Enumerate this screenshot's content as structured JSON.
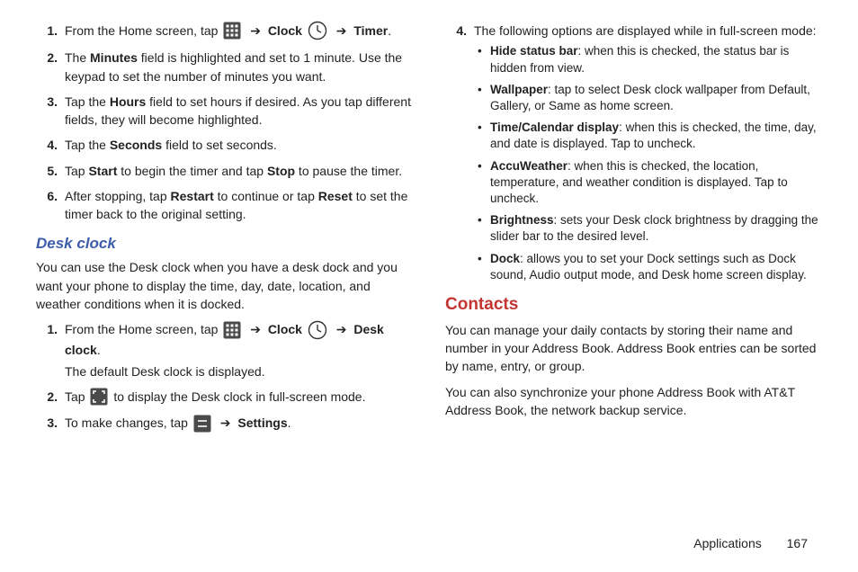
{
  "footer": {
    "section": "Applications",
    "page": "167"
  },
  "arrow_glyph": "➔",
  "left": {
    "steps1": [
      {
        "n": "1.",
        "pre": "From the Home screen, tap ",
        "icon1": "apps-grid-icon",
        "mid1": " ",
        "bold1": "Clock",
        "mid2": " ",
        "icon2": "clock-icon",
        "post": " ",
        "tail_bold": "Timer",
        "tail": "."
      },
      {
        "n": "2.",
        "text_a": "The ",
        "b1": "Minutes",
        "text_b": " field is highlighted and set to 1 minute. Use the keypad to set the number of minutes you want."
      },
      {
        "n": "3.",
        "text_a": "Tap the ",
        "b1": "Hours",
        "text_b": " field to set hours if desired. As you tap different fields, they will become highlighted."
      },
      {
        "n": "4.",
        "text_a": "Tap the ",
        "b1": "Seconds",
        "text_b": " field to set seconds."
      },
      {
        "n": "5.",
        "text_a": "Tap ",
        "b1": "Start",
        "text_b": " to begin the timer and tap ",
        "b2": "Stop",
        "text_c": " to pause the timer."
      },
      {
        "n": "6.",
        "text_a": "After stopping, tap ",
        "b1": "Restart",
        "text_b": " to continue or tap ",
        "b2": "Reset",
        "text_c": " to set the timer back to the original setting."
      }
    ],
    "desk_clock_heading": "Desk clock",
    "desk_clock_intro": "You can use the Desk clock when you have a desk dock and you want your phone to display the time, day, date, location, and weather conditions when it is docked.",
    "steps2": {
      "s1": {
        "n": "1.",
        "pre": "From the Home screen, tap ",
        "bold1": "Clock",
        "tail_bold": "Desk clock",
        "tail": ".",
        "sub": "The default Desk clock is displayed."
      },
      "s2": {
        "n": "2.",
        "pre": "Tap ",
        "post": " to display the Desk clock in full-screen mode."
      },
      "s3": {
        "n": "3.",
        "pre": "To make changes, tap ",
        "bold": "Settings",
        "post": "."
      }
    }
  },
  "right": {
    "step4": {
      "n": "4.",
      "text": "The following options are displayed while in full-screen mode:"
    },
    "bullets": [
      {
        "b": "Hide status bar",
        "t": ": when this is checked, the status bar is hidden from view."
      },
      {
        "b": "Wallpaper",
        "t": ": tap to select Desk clock wallpaper from Default, Gallery, or Same as home screen."
      },
      {
        "b": "Time/Calendar display",
        "t": ": when this is checked, the time, day, and date is displayed. Tap to uncheck."
      },
      {
        "b": "AccuWeather",
        "t": ": when this is checked, the location, temperature, and weather condition is displayed. Tap to uncheck."
      },
      {
        "b": "Brightness",
        "t": ": sets your Desk clock brightness by dragging the slider bar to the desired level."
      },
      {
        "b": "Dock",
        "t": ": allows you to set your Dock settings such as Dock sound, Audio output mode, and Desk home screen display."
      }
    ],
    "contacts_heading": "Contacts",
    "contacts_p1": "You can manage your daily contacts by storing their name and number in your Address Book. Address Book entries can be sorted by name, entry, or group.",
    "contacts_p2": "You can also synchronize your phone Address Book with AT&T Address Book, the network backup service."
  }
}
